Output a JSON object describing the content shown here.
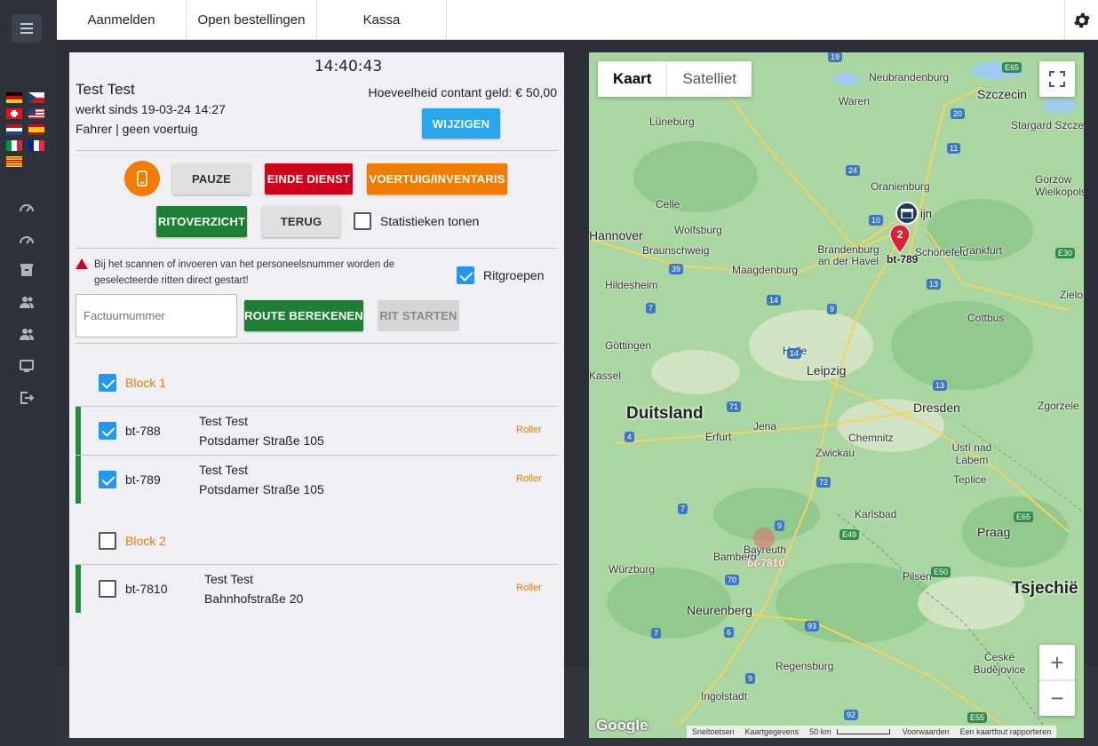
{
  "topbar": {
    "tabs": [
      "Aanmelden",
      "Open bestellingen",
      "Kassa"
    ]
  },
  "sidebar": {
    "flags": [
      "de",
      "cz",
      "ch",
      "us",
      "nl",
      "es",
      "it",
      "fr",
      "ca"
    ],
    "icons": [
      "gauge-icon",
      "gauge-icon",
      "box-icon",
      "users-icon",
      "users-icon",
      "monitor-icon",
      "logout-icon"
    ]
  },
  "panel": {
    "clock": "14:40:43",
    "driver_name": "Test Test",
    "since": "werkt sinds 19-03-24 14:27",
    "role": "Fahrer | geen voertuig",
    "cash_label": "Hoeveelheid contant geld: € 50,00",
    "buttons": {
      "change": "WIJZIGEN",
      "pause": "PAUZE",
      "end_shift": "EINDE DIENST",
      "vehicle": "VOERTUIG/INVENTARIS",
      "ride_overview": "RITOVERZICHT",
      "back": "TERUG",
      "calc_route": "ROUTE BEREKENEN",
      "start_ride": "RIT STARTEN"
    },
    "stats_label": "Statistieken tonen",
    "warning": "Bij het scannen of invoeren van het personeelsnummer worden de geselecteerde ritten direct gestart!",
    "ride_groups_label": "Ritgroepen",
    "invoice_placeholder": "Factuurnummer",
    "blocks": [
      {
        "label": "Block 1",
        "checked": true,
        "rides": [
          {
            "id": "bt-788",
            "name": "Test Test",
            "address": "Potsdamer Straße 105",
            "vehicle": "Roller",
            "checked": true
          },
          {
            "id": "bt-789",
            "name": "Test Test",
            "address": "Potsdamer Straße 105",
            "vehicle": "Roller",
            "checked": true
          }
        ]
      },
      {
        "label": "Block 2",
        "checked": false,
        "rides": [
          {
            "id": "bt-7810",
            "name": "Test Test",
            "address": "Bahnhofstraße 20",
            "vehicle": "Roller",
            "checked": false
          }
        ]
      }
    ]
  },
  "map": {
    "tabs": [
      "Kaart",
      "Satelliet"
    ],
    "active_tab": "Kaart",
    "countries": [
      "Duitsland",
      "Tsjechië"
    ],
    "cities": [
      "Neubrandenburg",
      "Szczecin",
      "Waren",
      "Stargard Szczeciński",
      "Lüneburg",
      "Oranienburg",
      "Gorzów Wielkopolski",
      "Celle",
      "Wolfsburg",
      "Hannover",
      "Braunschweig",
      "Brandenburg an der Havel",
      "Schönefeld",
      "Frankfurt",
      "Hildesheim",
      "Maagdenburg",
      "Zielona",
      "Cottbus",
      "Göttingen",
      "Halle",
      "Leipzig",
      "Dresden",
      "Erfurt",
      "Jena",
      "Chemnitz",
      "Zwickau",
      "Ústí nad Labem",
      "Teplice",
      "Zgorzele",
      "Karlsbad",
      "Bamberg",
      "Bayreuth",
      "Würzburg",
      "Praag",
      "Pilsen",
      "Neurenberg",
      "Regensburg",
      "České Budějovice",
      "Ingolstadt",
      "Kassel"
    ],
    "markers": [
      {
        "label": "bt-789",
        "count": "2"
      },
      {
        "label": "bt-7810"
      }
    ],
    "berlin_partial": "ijn",
    "attribution": [
      "Sneltoetsen",
      "Kaartgegevens",
      "50 km",
      "Voorwaarden",
      "Een kaartfout rapporteren"
    ],
    "google": "Google",
    "zoom_in": "+",
    "zoom_out": "−"
  }
}
